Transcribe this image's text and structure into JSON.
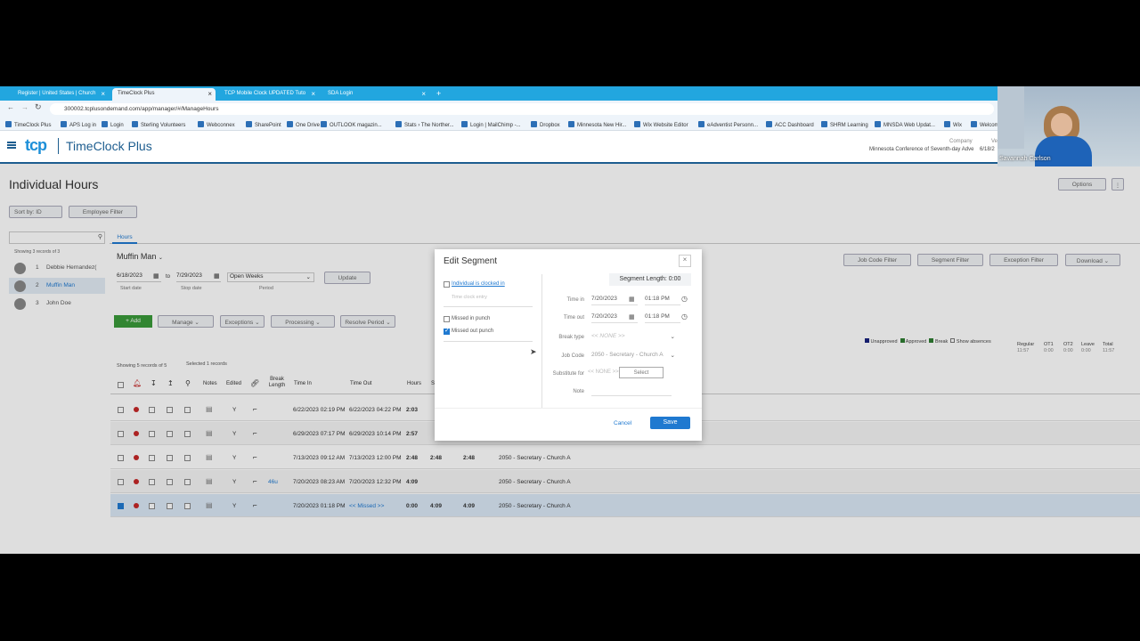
{
  "browser": {
    "tabs": [
      {
        "label": "Register | United States | Church"
      },
      {
        "label": "TimeClock Plus"
      },
      {
        "label": "TCP Mobile Clock UPDATED Tuto"
      },
      {
        "label": "SDA Login"
      }
    ],
    "new_tab": "+",
    "close": "×",
    "url": "300002.tcplusondemand.com/app/manager/#/ManageHours",
    "bookmarks": [
      "TimeClock Plus",
      "APS Log in",
      "Login",
      "Sterling Volunteers",
      "Webconnex",
      "SharePoint",
      "One Drive",
      "OUTLOOK magazin...",
      "Stats › The Norther...",
      "Login | MailChimp -...",
      "Dropbox",
      "Minnesota New Hir...",
      "Wix Website Editor",
      "eAdventist Personn...",
      "ACC Dashboard",
      "SHRM Learning",
      "MNSDA Web Updat...",
      "Wix",
      "Welcom"
    ]
  },
  "header": {
    "logo_text": "tcp",
    "brand": "TimeClock Plus",
    "company_label": "Company",
    "company_name": "Minnesota Conference of Seventh-day Adve",
    "date": "6/18/2",
    "webcam_name": "Savannah Carlson",
    "extra": "Ve"
  },
  "page": {
    "title": "Individual Hours",
    "options": "Options",
    "sort_by": "Sort by: ID",
    "employee_filter": "Employee Filter",
    "showing_employees": "Showing 3 records of 3",
    "hours_tab": "Hours"
  },
  "employees": [
    {
      "num": "1",
      "name": "Debbie Hernandez("
    },
    {
      "num": "2",
      "name": "Muffin Man"
    },
    {
      "num": "3",
      "name": "John Doe"
    }
  ],
  "main": {
    "employee": "Muffin Man",
    "start_date": "6/18/2023",
    "to": "to",
    "stop_date": "7/29/2023",
    "period": "Open Weeks",
    "start_label": "Start date",
    "stop_label": "Stop date",
    "period_label": "Period",
    "update": "Update",
    "add": "+ Add",
    "manage": "Manage",
    "exceptions": "Exceptions",
    "processing": "Processing",
    "resolve": "Resolve Period",
    "job_code_filter": "Job Code Filter",
    "segment_filter": "Segment Filter",
    "exception_filter": "Exception Filter",
    "download": "Download",
    "legend": [
      "Unapproved",
      "Approved",
      "Break",
      "Show absences"
    ],
    "legend_colors": [
      "#1a237e",
      "#2e7d32",
      "#2e7d32"
    ],
    "showing_records": "Showing 5 records of 5",
    "selected": "Selected 1 records",
    "totals": {
      "headers": [
        "Regular",
        "OT1",
        "OT2",
        "Leave",
        "Total"
      ],
      "values": [
        "11:57",
        "0:00",
        "0:00",
        "0:00",
        "11:57"
      ]
    }
  },
  "table": {
    "headers": {
      "notes": "Notes",
      "edited": "Edited",
      "break": "Break Length",
      "time_in": "Time In",
      "time_out": "Time Out",
      "hours": "Hours",
      "s": "S"
    },
    "rows": [
      {
        "edited": "Y",
        "brk": "",
        "time_in": "6/22/2023 02:19 PM",
        "time_out": "6/22/2023 04:22 PM",
        "hours": "2:03",
        "h2": "",
        "h3": "",
        "job": "",
        "checked": false
      },
      {
        "edited": "Y",
        "brk": "",
        "time_in": "6/29/2023 07:17 PM",
        "time_out": "6/29/2023 10:14 PM",
        "hours": "2:57",
        "h2": "",
        "h3": "",
        "job": "",
        "checked": false
      },
      {
        "edited": "Y",
        "brk": "",
        "time_in": "7/13/2023 09:12 AM",
        "time_out": "7/13/2023 12:00 PM",
        "hours": "2:48",
        "h2": "2:48",
        "h3": "2:48",
        "job": "2050 - Secretary - Church A",
        "checked": false
      },
      {
        "edited": "Y",
        "brk": "46u",
        "time_in": "7/20/2023 08:23 AM",
        "time_out": "7/20/2023 12:32 PM",
        "hours": "4:09",
        "h2": "",
        "h3": "",
        "job": "2050 - Secretary - Church A",
        "checked": false
      },
      {
        "edited": "Y",
        "brk": "",
        "time_in": "7/20/2023 01:18 PM",
        "time_out": "<< Missed >>",
        "hours": "0:00",
        "h2": "4:09",
        "h3": "4:09",
        "job": "2050 - Secretary - Church A",
        "checked": true
      }
    ]
  },
  "modal": {
    "title": "Edit Segment",
    "close": "×",
    "segment_length": "Segment Length: 0:00",
    "clocked_in": "Individual is clocked in",
    "time_clock_entry": "Time clock entry",
    "missed_in": "Missed in punch",
    "missed_out": "Missed out punch",
    "time_in_label": "Time in",
    "time_in_date": "7/20/2023",
    "time_in_time": "01:18 PM",
    "time_out_label": "Time out",
    "time_out_date": "7/20/2023",
    "time_out_time": "01:18 PM",
    "break_type_label": "Break type",
    "break_type": "<< NONE >>",
    "job_code_label": "Job Code",
    "job_code": "2050 - Secretary - Church A",
    "substitute_label": "Substitute for",
    "substitute": "<< NONE >>",
    "select": "Select",
    "note_label": "Note",
    "cancel": "Cancel",
    "save": "Save"
  }
}
